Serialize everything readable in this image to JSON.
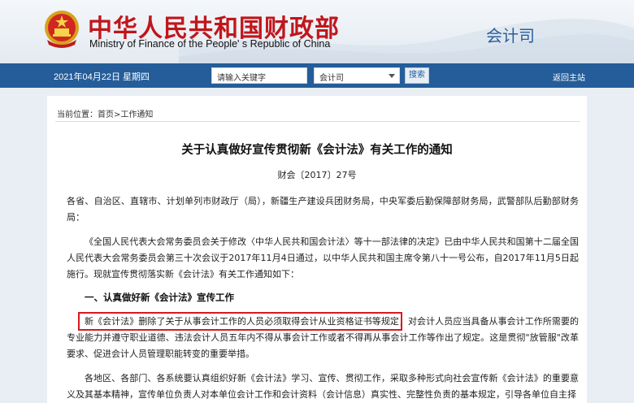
{
  "header": {
    "title_cn": "中华人民共和国财政部",
    "title_en": "Ministry of Finance of the People' s Republic of China",
    "department": "会计司"
  },
  "navbar": {
    "date": "2021年04月22日  星期四",
    "search_placeholder": "请输入关键字",
    "scope_selected": "会计司",
    "search_button": "搜索",
    "back_home": "返回主站"
  },
  "breadcrumb": {
    "prefix": "当前位置：",
    "home": "首页",
    "separator": ">",
    "current": "工作通知"
  },
  "article": {
    "title": "关于认真做好宣传贯彻新《会计法》有关工作的通知",
    "doc_number": "财会〔2017〕27号",
    "recipients": "各省、自治区、直辖市、计划单列市财政厅（局），新疆生产建设兵团财务局，中央军委后勤保障部财务局，武警部队后勤部财务局：",
    "intro": "《全国人民代表大会常务委员会关于修改〈中华人民共和国会计法〉等十一部法律的决定》已由中华人民共和国第十二届全国人民代表大会常务委员会第三十次会议于2017年11月4日通过，以中华人民共和国主席令第八十一号公布，自2017年11月5日起施行。现就宣传贯彻落实新《会计法》有关工作通知如下：",
    "section_heading": "一、认真做好新《会计法》宣传工作",
    "para_highlighted": "新《会计法》删除了关于从事会计工作的人员必须取得会计从业资格证书等规定，对会计人员应当具备从事会计工作所需要的专业能力并遵守职业道德、违法会计人员五年内不得从事会计工作或者不得再从事会计工作等作出了规定。这是贯彻\"放管服\"改革要求、促进会计人员管理职能转变的重要举措。",
    "para_next": "各地区、各部门、各系统要认真组织好新《会计法》学习、宣传、贯彻工作，采取多种形式向社会宣传新《会计法》的重要意义及其基本精神，宣传单位负责人对本单位会计工作和会计资料（会计信息）真实性、完整性负责的基本规定，引导各单位自主择"
  },
  "colors": {
    "brand_red": "#c0161b",
    "nav_blue": "#245d99",
    "highlight_red": "#d9181c"
  }
}
